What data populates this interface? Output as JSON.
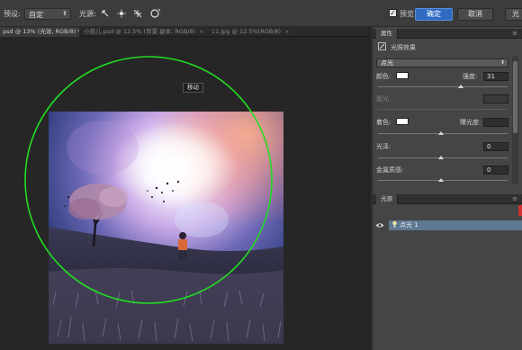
{
  "options_bar": {
    "preset_label": "预设:",
    "preset_value": "自定",
    "light_label": "光源:",
    "preview_checked": true,
    "preview_label": "预览",
    "ok_label": "确定",
    "cancel_label": "取消",
    "extra_label": "光"
  },
  "tabs": [
    {
      "label": "psd @ 13% (光效, RGB/8) *",
      "close": "×"
    },
    {
      "label": "小孩儿.psd @ 12.5% (背景 副本, RGB/8)",
      "close": "×"
    },
    {
      "label": "11.jpg @ 12.5%(RGB/8)",
      "close": "×"
    }
  ],
  "canvas": {
    "tooltip": "移动"
  },
  "properties": {
    "header": "属性",
    "panel_title": "光照效果",
    "light_type": "点光",
    "color_label": "颜色:",
    "intensity_label": "强度:",
    "intensity_value": "31",
    "hotspot_label": "聚光:",
    "colorize_label": "着色:",
    "exposure_label": "曝光度:",
    "exposure_value": "",
    "gloss_label": "光泽:",
    "gloss_value": "0",
    "metallic_label": "金属质感:",
    "metallic_value": "0"
  },
  "lights_panel": {
    "header": "光源",
    "items": [
      {
        "label": "点光 1"
      }
    ]
  },
  "colors": {
    "ok_button": "#2f6bc2",
    "selected_light": "#5f7893",
    "light_gizmo": "#22dd22"
  }
}
